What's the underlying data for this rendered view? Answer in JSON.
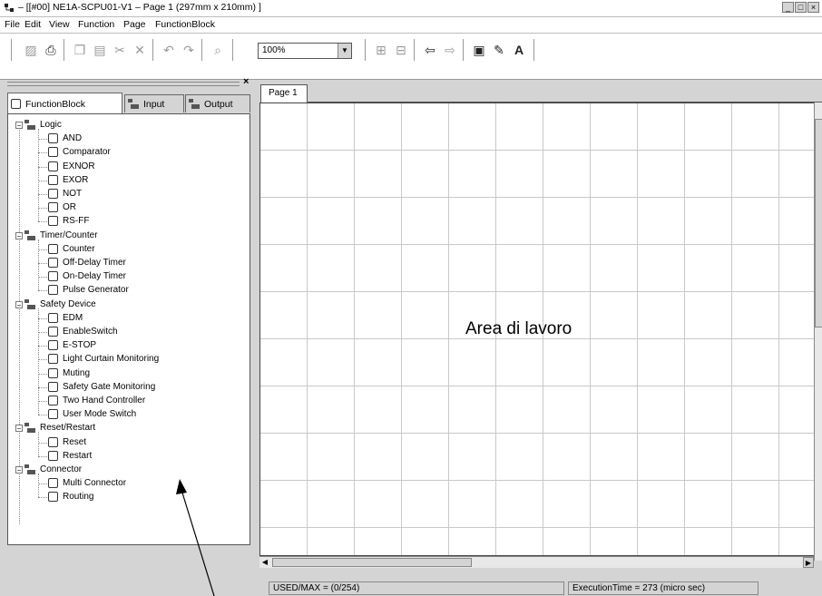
{
  "window": {
    "title": "– [[#00] NE1A-SCPU01-V1 – Page 1 (297mm x 210mm) ]",
    "controls": [
      "_",
      "□",
      "×"
    ]
  },
  "menu": [
    "File",
    "Edit",
    "View",
    "Function",
    "Page",
    "FunctionBlock"
  ],
  "toolbar": {
    "zoom_value": "100%",
    "buttons": [
      {
        "name": "new-icon",
        "glyph": "▨"
      },
      {
        "name": "print-icon",
        "glyph": "⎙"
      },
      {
        "name": "copy-icon",
        "glyph": "❐"
      },
      {
        "name": "paste-icon",
        "glyph": "▤"
      },
      {
        "name": "cut-icon",
        "glyph": "✂"
      },
      {
        "name": "delete-icon",
        "glyph": "✕"
      },
      {
        "name": "undo-icon",
        "glyph": "↶"
      },
      {
        "name": "redo-icon",
        "glyph": "↷"
      },
      {
        "name": "find-icon",
        "glyph": "⌕"
      },
      {
        "name": "zoom-in-icon",
        "glyph": "⊞"
      },
      {
        "name": "zoom-out-icon",
        "glyph": "⊟"
      },
      {
        "name": "page-prev-icon",
        "glyph": "⇦"
      },
      {
        "name": "page-next-icon",
        "glyph": "⇨"
      },
      {
        "name": "page-properties-icon",
        "glyph": "▣"
      },
      {
        "name": "edit-page-icon",
        "glyph": "✎"
      },
      {
        "name": "text-icon",
        "glyph": "A"
      }
    ]
  },
  "panel": {
    "tabs": [
      "FunctionBlock",
      "Input",
      "Output"
    ],
    "tree": [
      {
        "label": "Logic",
        "children": [
          "AND",
          "Comparator",
          "EXNOR",
          "EXOR",
          "NOT",
          "OR",
          "RS-FF"
        ]
      },
      {
        "label": "Timer/Counter",
        "children": [
          "Counter",
          "Off-Delay Timer",
          "On-Delay Timer",
          "Pulse Generator"
        ]
      },
      {
        "label": "Safety Device",
        "children": [
          "EDM",
          "EnableSwitch",
          "E-STOP",
          "Light Curtain Monitoring",
          "Muting",
          "Safety Gate Monitoring",
          "Two Hand Controller",
          "User Mode Switch"
        ]
      },
      {
        "label": "Reset/Restart",
        "children": [
          "Reset",
          "Restart"
        ]
      },
      {
        "label": "Connector",
        "children": [
          "Multi Connector",
          "Routing"
        ]
      }
    ]
  },
  "page_tab": "Page 1",
  "canvas_label": "Area di lavoro",
  "status": {
    "used": "USED/MAX = (0/254)",
    "execution": "ExecutionTime = 273 (micro sec)"
  }
}
